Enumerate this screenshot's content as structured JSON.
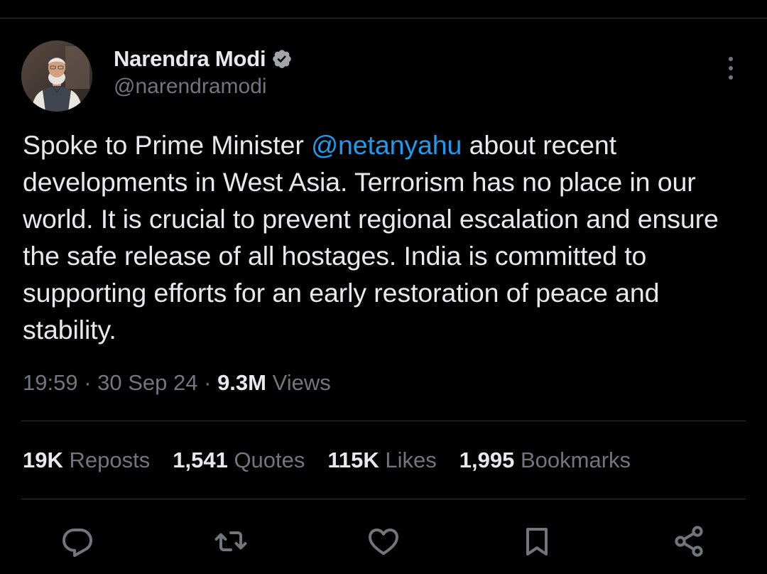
{
  "author": {
    "display_name": "Narendra Modi",
    "handle": "@narendramodi",
    "verified": true,
    "verified_icon": "verified-badge-icon"
  },
  "tweet": {
    "text_before_mention": "Spoke to Prime Minister ",
    "mention": "@netanyahu",
    "text_after_mention": " about recent developments in West Asia. Terrorism has no place in our world. It is crucial to prevent regional escalation and ensure the safe release of all hostages. India is committed to supporting efforts for an early restoration of peace and stability."
  },
  "meta": {
    "time": "19:59",
    "separator": " · ",
    "date": "30 Sep 24",
    "views_count": "9.3M",
    "views_label": " Views"
  },
  "stats": {
    "reposts_count": "19K",
    "reposts_label": "Reposts",
    "quotes_count": "1,541",
    "quotes_label": "Quotes",
    "likes_count": "115K",
    "likes_label": "Likes",
    "bookmarks_count": "1,995",
    "bookmarks_label": "Bookmarks"
  },
  "actions": [
    "reply-icon",
    "repost-icon",
    "like-icon",
    "bookmark-icon",
    "share-icon"
  ],
  "colors": {
    "background": "#000000",
    "text": "#e7e9ea",
    "secondary": "#71767b",
    "accent": "#1d9bf0",
    "divider": "#2f3336"
  }
}
